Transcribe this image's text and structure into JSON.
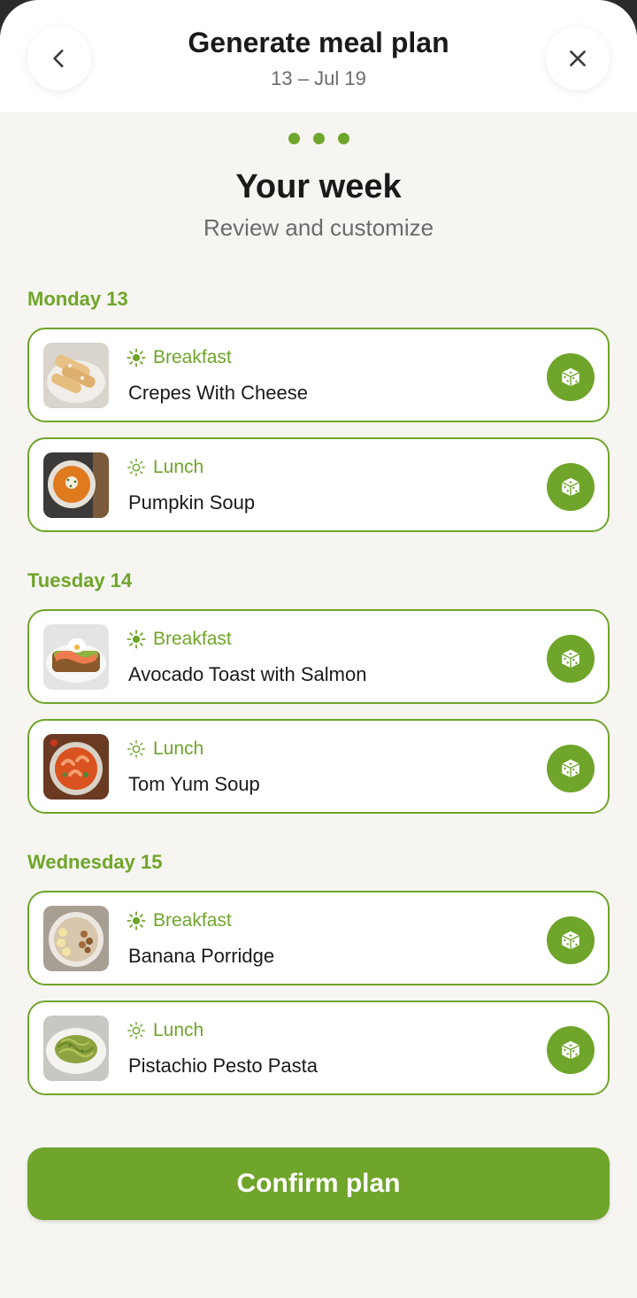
{
  "header": {
    "title": "Generate meal plan",
    "date_range": "13 – Jul 19"
  },
  "progress": {
    "steps": 3
  },
  "intro": {
    "title": "Your week",
    "subtitle": "Review and customize"
  },
  "days": [
    {
      "label": "Monday 13",
      "meals": [
        {
          "type": "Breakfast",
          "name": "Crepes With Cheese"
        },
        {
          "type": "Lunch",
          "name": "Pumpkin Soup"
        }
      ]
    },
    {
      "label": "Tuesday 14",
      "meals": [
        {
          "type": "Breakfast",
          "name": "Avocado Toast with Salmon"
        },
        {
          "type": "Lunch",
          "name": "Tom Yum Soup"
        }
      ]
    },
    {
      "label": "Wednesday 15",
      "meals": [
        {
          "type": "Breakfast",
          "name": "Banana Porridge"
        },
        {
          "type": "Lunch",
          "name": "Pistachio Pesto Pasta"
        }
      ]
    }
  ],
  "actions": {
    "confirm_label": "Confirm plan"
  },
  "colors": {
    "accent": "#6fa52a",
    "background": "#f6f5f1",
    "header": "#ffffff"
  },
  "icons": {
    "back": "chevron-left-icon",
    "close": "close-icon",
    "breakfast": "sun-filled-icon",
    "lunch": "sun-outline-icon",
    "shuffle": "dice-icon"
  }
}
